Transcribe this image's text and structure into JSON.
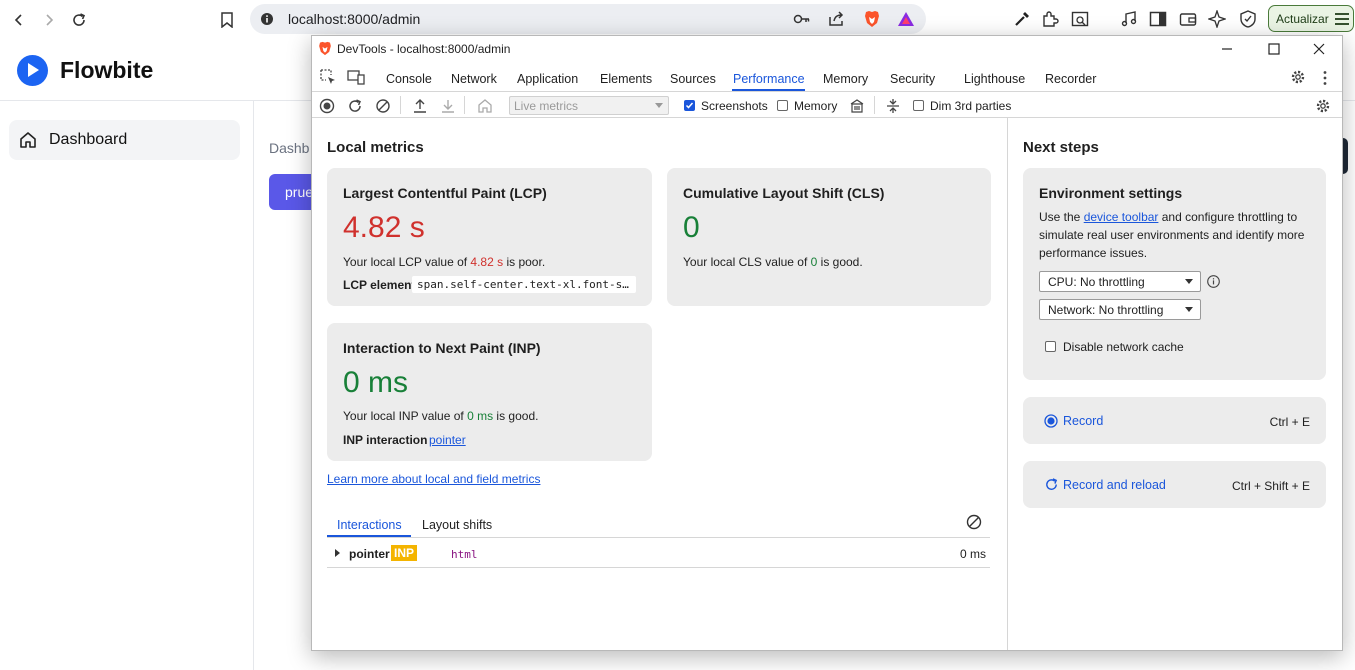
{
  "browser": {
    "url": "localhost:8000/admin",
    "update_label": "Actualizar"
  },
  "page": {
    "brand": "Flowbite",
    "sidebar_item": "Dashboard",
    "breadcrumb": "Dashb",
    "button_partial": "prue"
  },
  "devtools": {
    "title": "DevTools - localhost:8000/admin",
    "tabs": [
      "Console",
      "Network",
      "Application",
      "Elements",
      "Sources",
      "Performance",
      "Memory",
      "Security",
      "Lighthouse",
      "Recorder"
    ],
    "active_tab": "Performance",
    "toolbar": {
      "live_metrics": "Live metrics",
      "screenshots": "Screenshots",
      "memory": "Memory",
      "dim": "Dim 3rd parties"
    },
    "local": {
      "heading": "Local metrics",
      "lcp": {
        "title": "Largest Contentful Paint (LCP)",
        "value": "4.82 s",
        "desc_pre": "Your local LCP value of ",
        "desc_val": "4.82 s",
        "desc_post": " is poor.",
        "element_label": "LCP element",
        "element_code": "span.self-center.text-xl.font-s…"
      },
      "cls": {
        "title": "Cumulative Layout Shift (CLS)",
        "value": "0",
        "desc_pre": "Your local CLS value of ",
        "desc_val": "0",
        "desc_post": " is good."
      },
      "inp": {
        "title": "Interaction to Next Paint (INP)",
        "value": "0 ms",
        "desc_pre": "Your local INP value of ",
        "desc_val": "0 ms",
        "desc_post": " is good.",
        "interaction_label": "INP interaction",
        "interaction_link": "pointer"
      },
      "learn_more": "Learn more about local and field metrics",
      "subtabs": [
        "Interactions",
        "Layout shifts"
      ],
      "row": {
        "name": "pointer",
        "badge": "INP",
        "node": "html",
        "time": "0 ms"
      }
    },
    "next": {
      "heading": "Next steps",
      "env_title": "Environment settings",
      "env_desc_pre": "Use the ",
      "env_link": "device toolbar",
      "env_desc_post": " and configure throttling to simulate real user environments and identify more performance issues.",
      "cpu": "CPU: No throttling",
      "network": "Network: No throttling",
      "disable_cache": "Disable network cache",
      "record": "Record",
      "record_shortcut": "Ctrl + E",
      "record_reload": "Record and reload",
      "record_reload_shortcut": "Ctrl + Shift + E"
    }
  },
  "colors": {
    "accent": "#1a56db",
    "poor": "#d0312d",
    "good": "#188038",
    "inp_badge": "#f4b400"
  }
}
